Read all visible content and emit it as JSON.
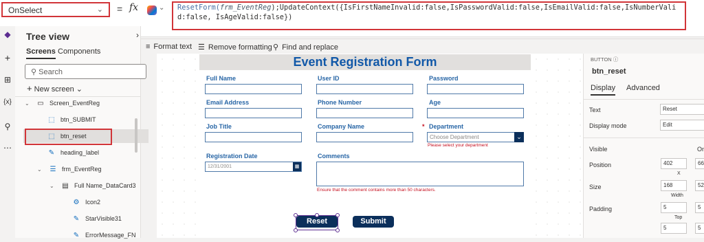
{
  "formula_bar": {
    "property": "OnSelect",
    "equals": "=",
    "fx": "fx",
    "formula_fn": "ResetForm(",
    "formula_arg": "frm_EventReg",
    "formula_rest": ");UpdateContext({IsFirstNameInvalid:false,IsPasswordValid:false,IsEmailValid:false,IsNumberValid:false, IsAgeValid:false})"
  },
  "format_toolbar": {
    "format_text": "Format text",
    "remove_formatting": "Remove formatting",
    "find_replace": "Find and replace"
  },
  "tree_view": {
    "title": "Tree view",
    "tabs": [
      "Screens",
      "Components"
    ],
    "search_placeholder": "Search",
    "new_screen": "New screen",
    "nodes": [
      "Screen_EventReg",
      "btn_SUBMIT",
      "btn_reset",
      "heading_label",
      "frm_EventReg",
      "Full Name_DataCard3",
      "Icon2",
      "StarVisible31",
      "ErrorMessage_FN"
    ]
  },
  "form": {
    "title": "Event Registration Form",
    "fields": {
      "full_name": "Full Name",
      "user_id": "User ID",
      "password": "Password",
      "email": "Email Address",
      "phone": "Phone Number",
      "age": "Age",
      "job_title": "Job Title",
      "company": "Company Name",
      "department": "Department",
      "department_required": "*",
      "department_placeholder": "Choose Department",
      "department_error": "Please select your department",
      "reg_date": "Registration Date",
      "reg_date_value": "12/31/2001",
      "comments": "Comments",
      "comments_error": "Ensure that the comment contains more than 50 characters."
    },
    "buttons": {
      "reset": "Reset",
      "submit": "Submit"
    }
  },
  "properties": {
    "type": "BUTTON",
    "name": "btn_reset",
    "tabs": [
      "Display",
      "Advanced"
    ],
    "text_label": "Text",
    "text_value": "Reset",
    "display_mode_label": "Display mode",
    "display_mode_value": "Edit",
    "visible_label": "Visible",
    "visible_value": "On",
    "position_label": "Position",
    "position_x": "402",
    "position_y": "66",
    "x_label": "X",
    "size_label": "Size",
    "size_w": "168",
    "size_h": "52",
    "width_label": "Width",
    "padding_label": "Padding",
    "pad_top": "5",
    "pad_right": "5",
    "top_label": "Top",
    "pad_bottom": "5",
    "pad_left": "5"
  },
  "colors": {
    "accent": "#1158a8",
    "button": "#0b2f5b",
    "error": "#c50f1f",
    "highlight": "#d13438"
  }
}
